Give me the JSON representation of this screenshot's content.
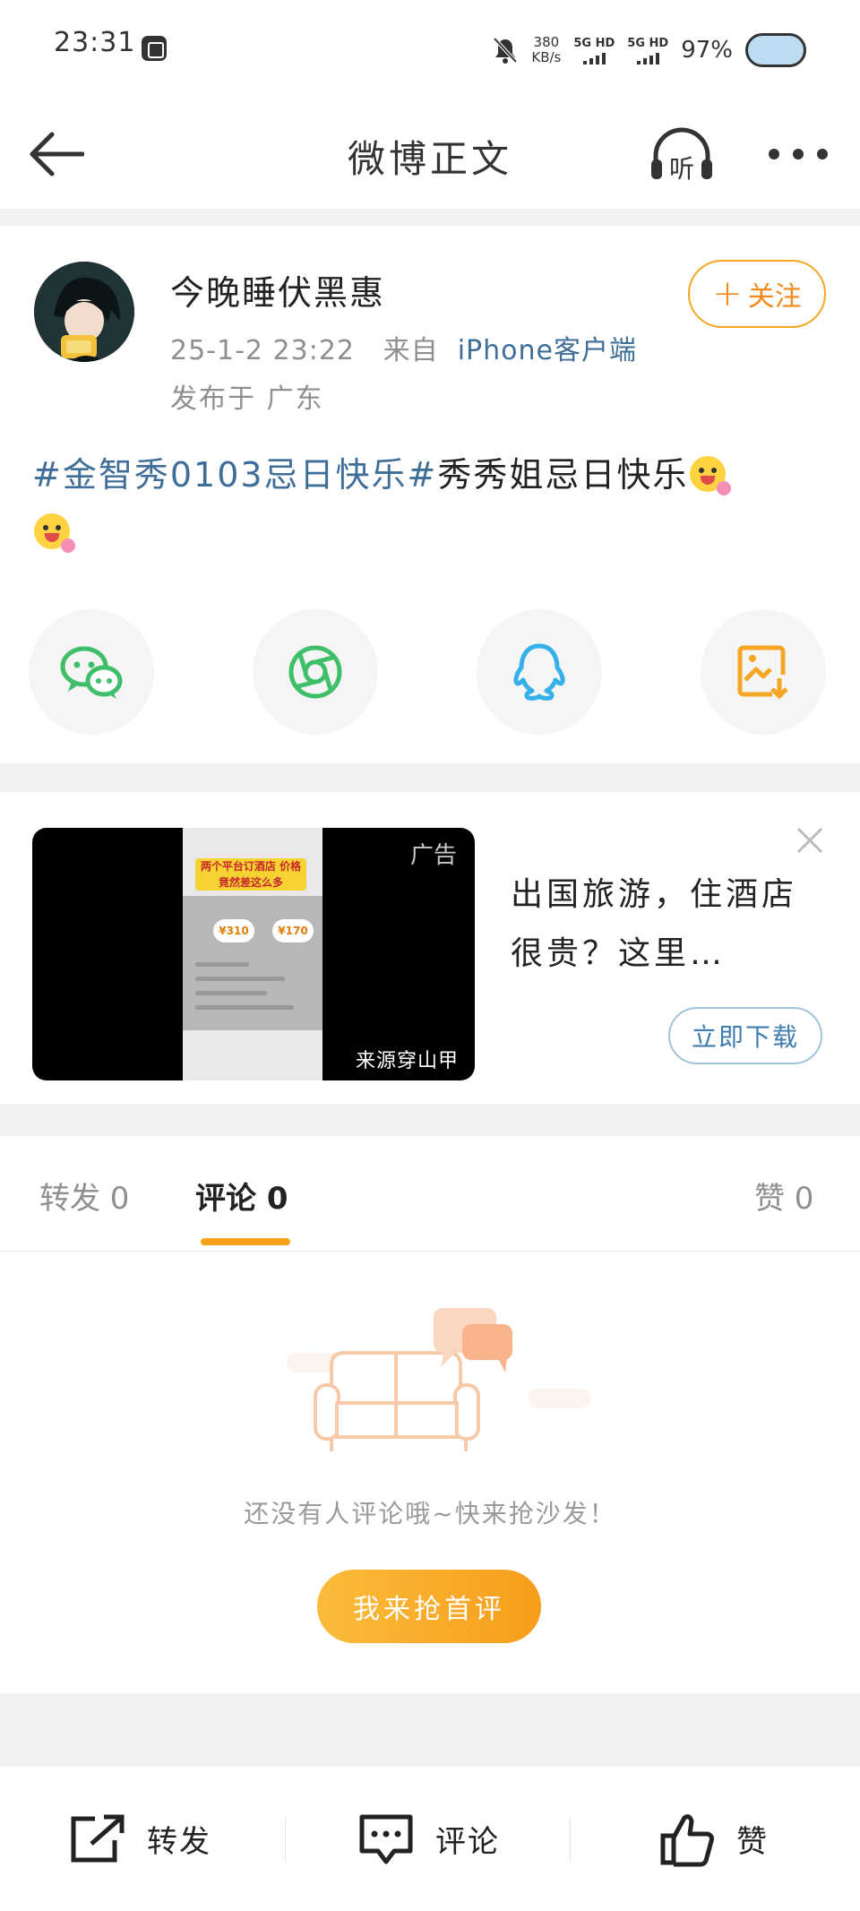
{
  "status_bar": {
    "time": "23:31",
    "net_speed_value": "380",
    "net_speed_unit": "KB/s",
    "signal_1": "5G HD",
    "signal_2": "5G HD",
    "battery": "97%"
  },
  "nav": {
    "title": "微博正文",
    "listen_label": "听"
  },
  "post": {
    "username": "今晚睡伏黑惠",
    "follow_label": "关注",
    "follow_plus": "+",
    "date": "25-1-2 23:22",
    "source_prefix": "来自",
    "source_name": "iPhone客户端",
    "location": "发布于 广东",
    "hashtag": "#金智秀0103忌日快乐#",
    "text_rest": "秀秀姐忌日快乐"
  },
  "share_icons": [
    "wechat-icon",
    "moments-icon",
    "qq-icon",
    "save-image-icon"
  ],
  "ad": {
    "label": "广告",
    "source": "来源穿山甲",
    "headline": "出国旅游，住酒店很贵？这里…",
    "download_label": "立即下载",
    "inner_banner": "两个平台订酒店 价格竟然差这么多",
    "price_1": "¥310",
    "price_2": "¥170"
  },
  "tabs": {
    "repost": "转发 0",
    "comment": "评论 0",
    "like": "赞 0"
  },
  "empty_state": {
    "text": "还没有人评论哦~快来抢沙发！",
    "button": "我来抢首评"
  },
  "bottom_bar": {
    "repost": "转发",
    "comment": "评论",
    "like": "赞"
  },
  "colors": {
    "accent_orange": "#f7a21b",
    "link_blue": "#3f6e99",
    "wechat_green": "#3fbf6a",
    "qq_blue": "#34b1e8",
    "save_orange": "#f5a623"
  }
}
